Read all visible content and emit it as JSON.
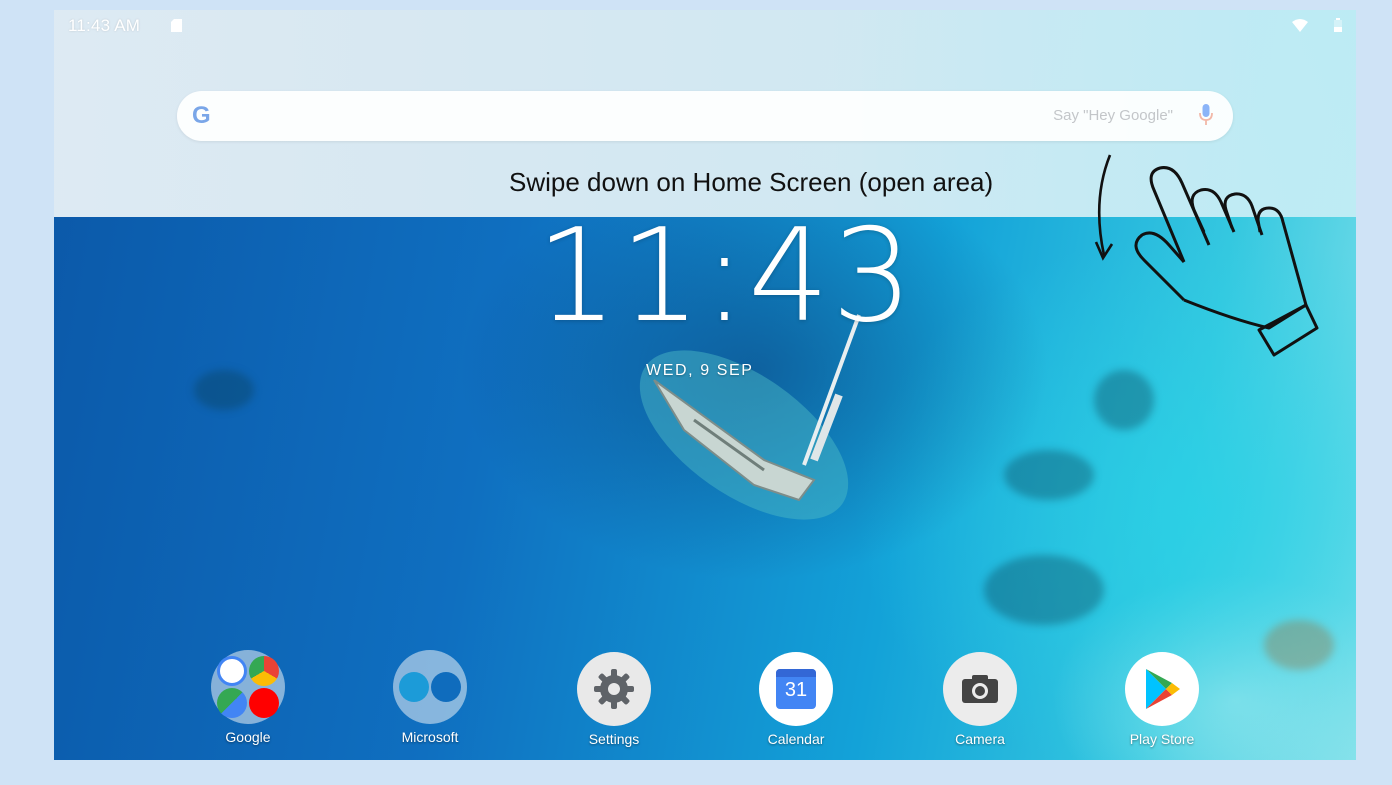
{
  "status_bar": {
    "time": "11:43 AM",
    "icons": [
      "sdcard-icon",
      "wifi-icon",
      "battery-icon"
    ]
  },
  "search": {
    "logo": "G",
    "hint": "Say \"Hey Google\"",
    "icons": [
      "google-logo-icon",
      "mic-icon"
    ]
  },
  "annotation": {
    "text": "Swipe down on Home Screen (open area)",
    "icons": [
      "swipe-arrow-icon",
      "hand-pointer-icon"
    ]
  },
  "clock": {
    "time": "11:43",
    "date": "WED, 9 SEP"
  },
  "dock": {
    "items": [
      {
        "label": "Google",
        "icon": "google-folder-icon"
      },
      {
        "label": "Microsoft",
        "icon": "microsoft-folder-icon"
      },
      {
        "label": "Settings",
        "icon": "settings-gear-icon"
      },
      {
        "label": "Calendar",
        "icon": "calendar-icon",
        "badge": "31"
      },
      {
        "label": "Camera",
        "icon": "camera-icon"
      },
      {
        "label": "Play Store",
        "icon": "play-store-icon"
      }
    ]
  },
  "colors": {
    "accent_blue": "#4285f4",
    "page_background": "#cfe3f6",
    "ocean_deep": "#0b58a8",
    "ocean_light": "#35c8e0"
  }
}
